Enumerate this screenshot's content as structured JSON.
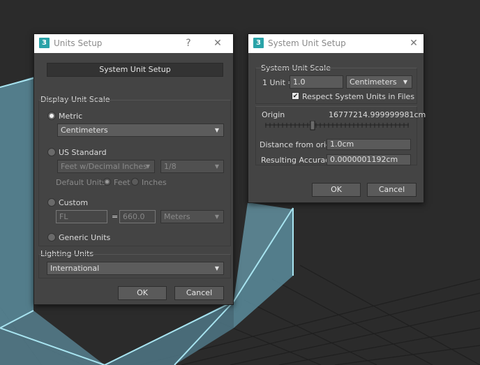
{
  "units_setup": {
    "title": "Units Setup",
    "help_glyph": "?",
    "close_glyph": "✕",
    "system_unit_setup_button": "System Unit Setup",
    "display_unit_scale": {
      "group_label": "Display Unit Scale",
      "metric_label": "Metric",
      "metric_value": "Centimeters",
      "us_standard_label": "US Standard",
      "us_unit_value": "Feet w/Decimal Inches",
      "us_fraction_value": "1/8",
      "default_units_label": "Default Units:",
      "feet_label": "Feet",
      "inches_label": "Inches",
      "custom_label": "Custom",
      "custom_name_value": "FL",
      "custom_equals": "=",
      "custom_amount_value": "660.0",
      "custom_unit_value": "Meters",
      "generic_units_label": "Generic Units"
    },
    "lighting_units": {
      "group_label": "Lighting Units",
      "value": "International"
    },
    "ok_label": "OK",
    "cancel_label": "Cancel"
  },
  "system_unit_setup": {
    "title": "System Unit Setup",
    "close_glyph": "✕",
    "scale_group_label": "System Unit Scale",
    "one_unit_label": "1 Unit =",
    "one_unit_value": "1.0",
    "unit_value": "Centimeters",
    "respect_label": "Respect System Units in Files",
    "respect_check": "✔",
    "origin_label": "Origin",
    "origin_value": "16777214.999999981cm",
    "distance_label": "Distance from origin:",
    "distance_value": "1.0cm",
    "accuracy_label": "Resulting Accuracy:",
    "accuracy_value": "0.0000001192cm",
    "ok_label": "OK",
    "cancel_label": "Cancel"
  },
  "colors": {
    "viewport_bg": "#2b2b2b",
    "cube_edge": "#a8e4f0",
    "cube_face": "#5f8fa0",
    "dialog_bg": "#444444",
    "app_icon": "#2aa3a8"
  },
  "icons": {
    "app": "3ds-max-icon",
    "dropdown": "chevron-down-icon"
  },
  "app_icon_glyph": "3"
}
